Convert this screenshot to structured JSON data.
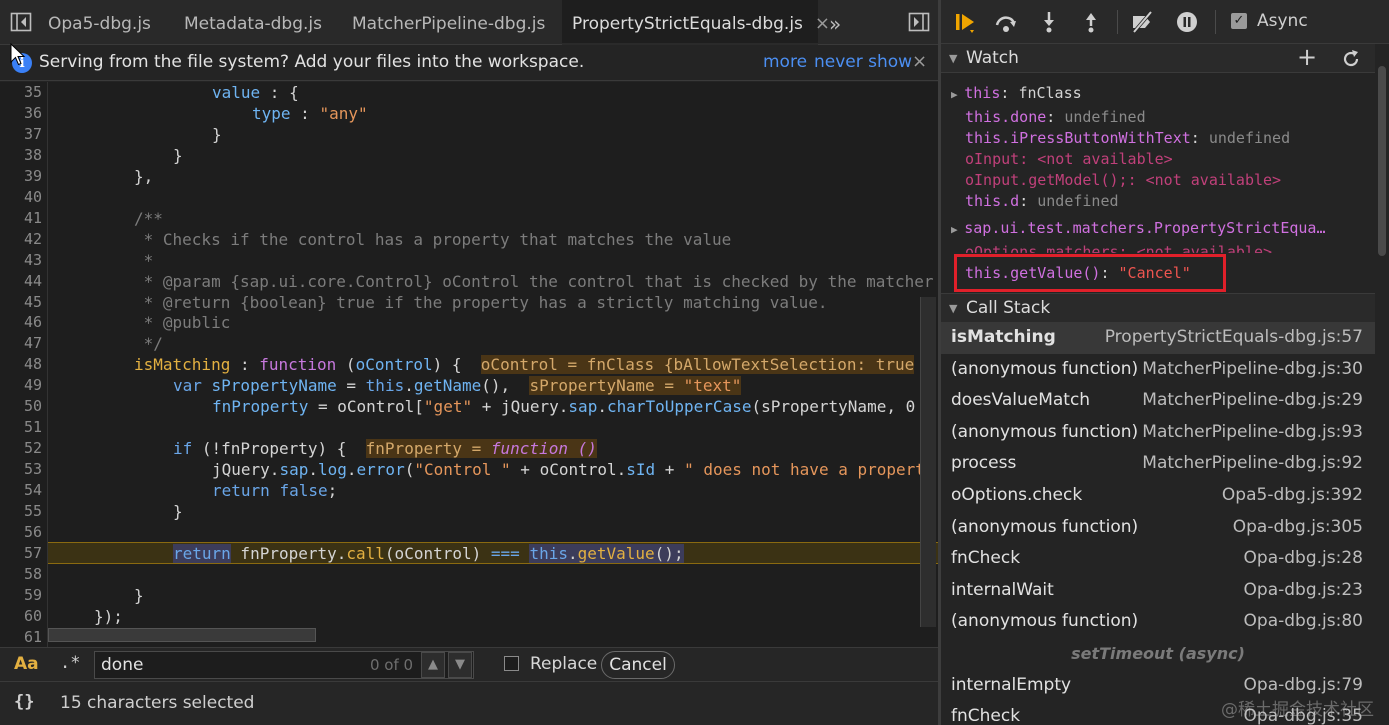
{
  "tabs": [
    {
      "label": "Opa5-dbg.js"
    },
    {
      "label": "Metadata-dbg.js"
    },
    {
      "label": "MatcherPipeline-dbg.js"
    },
    {
      "label": "PropertyStrictEquals-dbg.js",
      "close": "×"
    }
  ],
  "tab_overflow": "»",
  "infobar": {
    "message": "Serving from the file system? Add your files into the workspace.",
    "more": "more",
    "never_show": "never show",
    "close": "×"
  },
  "code_lines": [
    {
      "n": "35"
    },
    {
      "n": "36"
    },
    {
      "n": "37"
    },
    {
      "n": "38"
    },
    {
      "n": "39"
    },
    {
      "n": "40"
    },
    {
      "n": "41"
    },
    {
      "n": "42"
    },
    {
      "n": "43"
    },
    {
      "n": "44"
    },
    {
      "n": "45"
    },
    {
      "n": "46"
    },
    {
      "n": "47"
    },
    {
      "n": "48"
    },
    {
      "n": "49"
    },
    {
      "n": "50"
    },
    {
      "n": "51"
    },
    {
      "n": "52"
    },
    {
      "n": "53"
    },
    {
      "n": "54"
    },
    {
      "n": "55"
    },
    {
      "n": "56"
    },
    {
      "n": "57"
    },
    {
      "n": "58"
    },
    {
      "n": "59"
    },
    {
      "n": "60"
    },
    {
      "n": "61"
    }
  ],
  "code": {
    "l35a": "value",
    "l35b": " : {",
    "l36a": "type",
    "l36b": " : ",
    "l36c": "\"any\"",
    "l37": "}",
    "l38": "}",
    "l39": "},",
    "l41": "/**",
    "l42": " * Checks if the control has a property that matches the value",
    "l43": " *",
    "l44": " * @param {sap.ui.core.Control} oControl the control that is checked by the matcher",
    "l45": " * @return {boolean} true if the property has a strictly matching value.",
    "l46": " * @public",
    "l47": " */",
    "l48a": "isMatching",
    "l48b": " : ",
    "l48c": "function",
    "l48d": " (",
    "l48e": "oControl",
    "l48f": ") {  ",
    "l48i": "oControl = fnClass {bAllowTextSelection: true",
    "l49a": "var ",
    "l49b": "sPropertyName",
    "l49c": " = ",
    "l49d": "this",
    "l49e": ".",
    "l49f": "getName",
    "l49g": "(),  ",
    "l49i1": "sPropertyName = ",
    "l49i2": "\"text\"",
    "l50a": "fnProperty",
    "l50b": " = oControl[",
    "l50c": "\"get\"",
    "l50d": " + jQuery.",
    "l50e": "sap",
    "l50f": ".",
    "l50g": "charToUpperCase",
    "l50h": "(sPropertyName, 0",
    "l52a": "if",
    "l52b": " (!fnProperty) {  ",
    "l52i1": "fnProperty = ",
    "l52i2": "function ()",
    "l53a": "jQuery.",
    "l53b": "sap",
    "l53c": ".",
    "l53d": "log",
    "l53e": ".",
    "l53f": "error",
    "l53g": "(",
    "l53h": "\"Control \"",
    "l53i": " + oControl.",
    "l53j": "sId",
    "l53k": " + ",
    "l53l": "\" does not have a property",
    "l54a": "return ",
    "l54b": "false",
    "l54c": ";",
    "l55": "}",
    "l57a": "return",
    "l57b": " fnProperty.",
    "l57c": "call",
    "l57d": "(oControl) ",
    "l57e": "===",
    "l57f": " ",
    "l57g": "this",
    "l57h": ".",
    "l57i": "getValue",
    "l57j": "();",
    "l59": "}",
    "l60": "});"
  },
  "find": {
    "match_case": "Aa",
    "regex": ".*",
    "query": "done",
    "count": "0 of 0",
    "replace_label": "Replace",
    "cancel": "Cancel"
  },
  "status": {
    "icon": "{}",
    "text": "15 characters selected"
  },
  "debugger": {
    "async_label": "Async",
    "watch_title": "Watch",
    "watch_add": "+",
    "callstack_title": "Call Stack",
    "watch": [
      {
        "name": "this",
        "sep": ": ",
        "value": "fnClass",
        "expandable": true
      },
      {
        "name": "this.done",
        "sep": ": ",
        "value": "undefined"
      },
      {
        "name": "this.iPressButtonWithText",
        "sep": ": ",
        "value": "undefined"
      },
      {
        "name": "oInput",
        "sep": ": ",
        "value": "<not available>"
      },
      {
        "name": "oInput.getModel();",
        "sep": ": ",
        "value": "<not available>"
      },
      {
        "name": "this.d",
        "sep": ": ",
        "value": "undefined"
      },
      {
        "name": "sap.ui.test.matchers.PropertyStrictEqua…",
        "sep": "",
        "value": "",
        "expandable": true
      },
      {
        "name": "oOptions.matchers",
        "sep": ": ",
        "value": "<not available>"
      },
      {
        "name": "this.getValue()",
        "sep": ": ",
        "value": "\"Cancel\""
      }
    ],
    "call_stack": [
      {
        "fn": "isMatching",
        "loc": "PropertyStrictEquals-dbg.js:57"
      },
      {
        "fn": "(anonymous function)",
        "loc": "MatcherPipeline-dbg.js:30"
      },
      {
        "fn": "doesValueMatch",
        "loc": "MatcherPipeline-dbg.js:29"
      },
      {
        "fn": "(anonymous function)",
        "loc": "MatcherPipeline-dbg.js:93"
      },
      {
        "fn": "process",
        "loc": "MatcherPipeline-dbg.js:92"
      },
      {
        "fn": "oOptions.check",
        "loc": "Opa5-dbg.js:392"
      },
      {
        "fn": "(anonymous function)",
        "loc": "Opa-dbg.js:305"
      },
      {
        "fn": "fnCheck",
        "loc": "Opa-dbg.js:28"
      },
      {
        "fn": "internalWait",
        "loc": "Opa-dbg.js:23"
      },
      {
        "fn": "(anonymous function)",
        "loc": "Opa-dbg.js:80"
      },
      {
        "fn": "internalEmpty",
        "loc": "Opa-dbg.js:79"
      },
      {
        "fn": "fnCheck",
        "loc": "Opa-dbg.js:35"
      }
    ],
    "async_separator": "setTimeout (async)"
  },
  "watermark": "@稀土掘金技术社区"
}
